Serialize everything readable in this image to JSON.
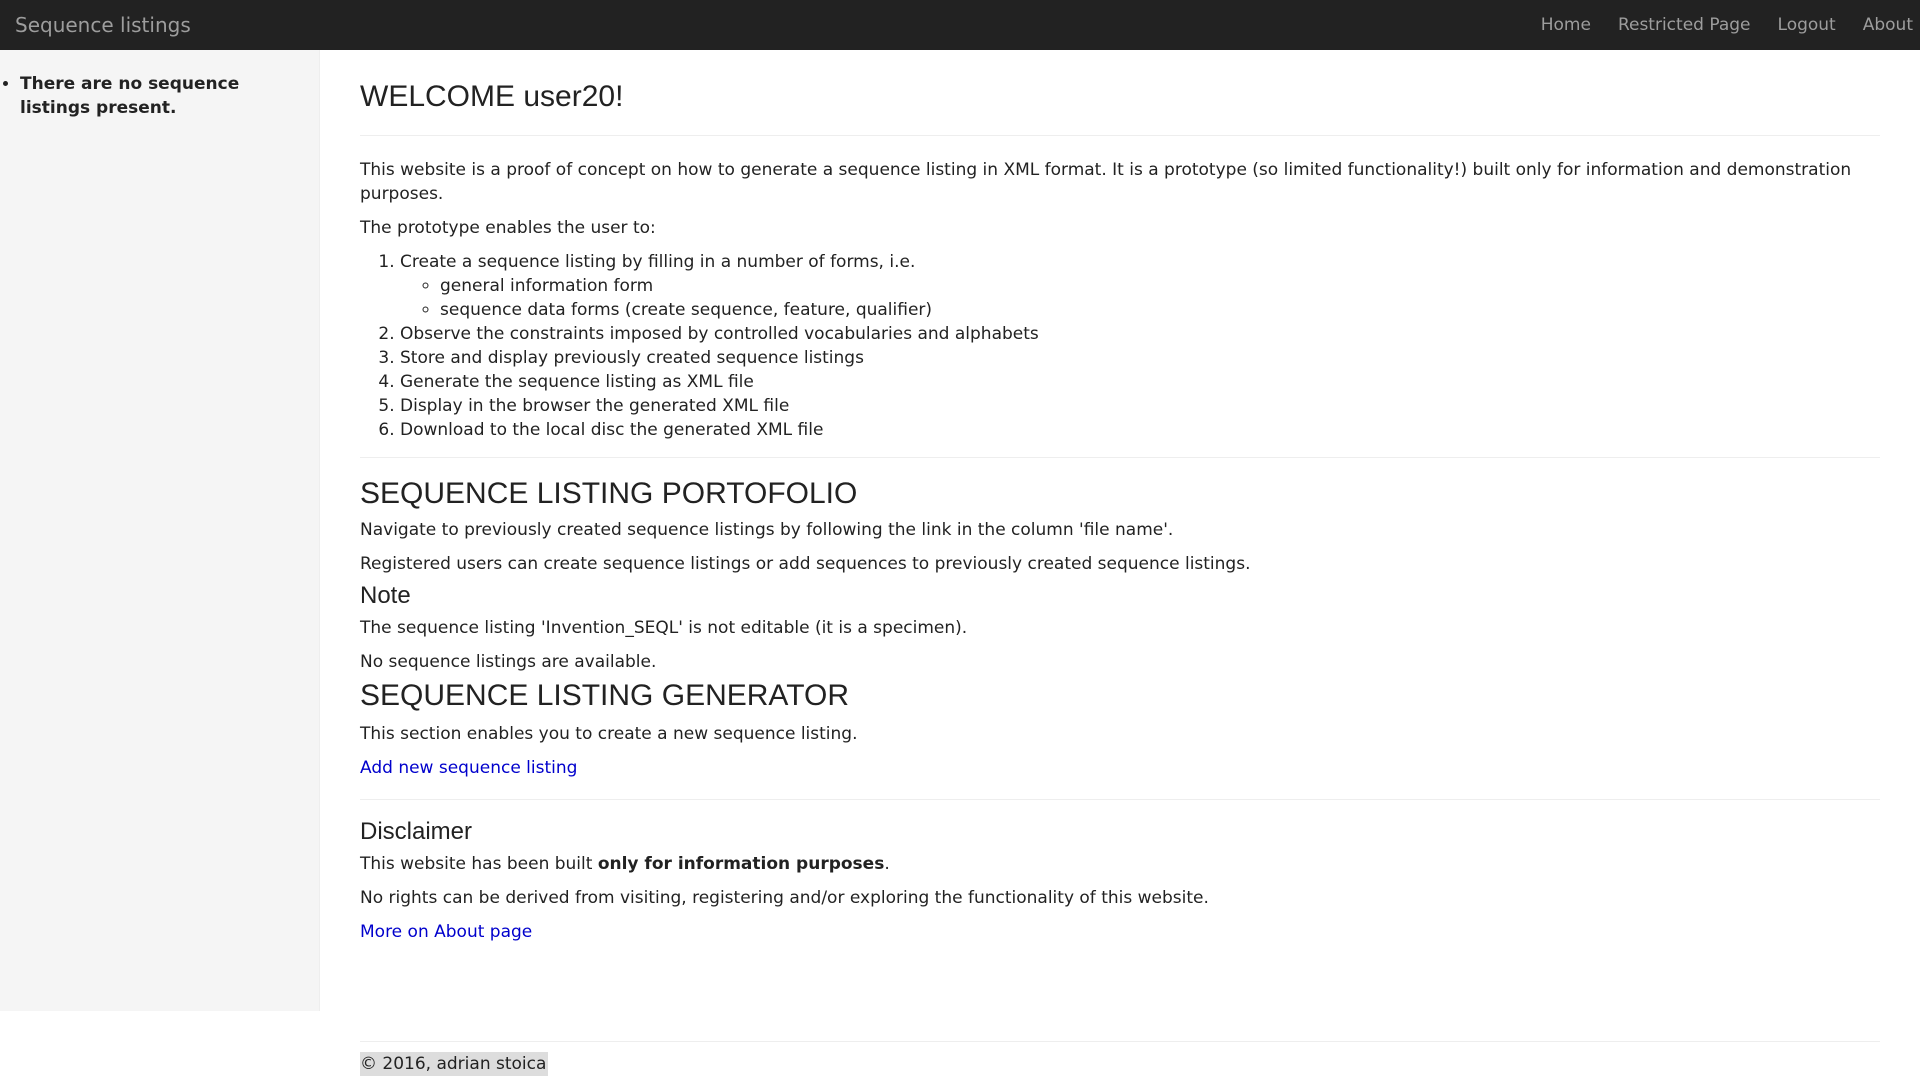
{
  "navbar": {
    "brand": "Sequence listings",
    "links": [
      "Home",
      "Restricted Page",
      "Logout",
      "About"
    ]
  },
  "sidebar": {
    "items": [
      "There are no sequence listings present."
    ]
  },
  "main": {
    "welcome": "WELCOME user20!",
    "intro": "This website is a proof of concept on how to generate a sequence listing in XML format. It is a prototype (so limited functionality!) built only for information and demonstration purposes.",
    "enables": "The prototype enables the user to:",
    "tasks": [
      "Create a sequence listing by filling in a number of forms, i.e.",
      "Observe the constraints imposed by controlled vocabularies and alphabets",
      "Store and display previously created sequence listings",
      "Generate the sequence listing as XML file",
      "Display in the browser the generated XML file",
      "Download to the local disc the generated XML file"
    ],
    "subtasks": [
      "general information form",
      "sequence data forms (create sequence, feature, qualifier)"
    ],
    "portfolio_title": "SEQUENCE LISTING PORTOFOLIO",
    "portfolio_nav": "Navigate to previously created sequence listings by following the link in the column 'file name'.",
    "portfolio_registered": "Registered users can create sequence listings or add sequences to previously created sequence listings.",
    "note_title": "Note",
    "note_text": "The sequence listing 'Invention_SEQL' is not editable (it is a specimen).",
    "no_listings": "No sequence listings are available.",
    "generator_title": "SEQUENCE LISTING GENERATOR",
    "generator_text": "This section enables you to create a new sequence listing.",
    "add_link": "Add new sequence listing",
    "disclaimer_title": "Disclaimer",
    "disclaimer_prefix": "This website has been built ",
    "disclaimer_bold": "only for information purposes",
    "disclaimer_suffix": ".",
    "rights": "No rights can be derived from visiting, registering and/or exploring the functionality of this website.",
    "about_link": "More on About page"
  },
  "footer": {
    "text": "© 2016, adrian stoica"
  }
}
